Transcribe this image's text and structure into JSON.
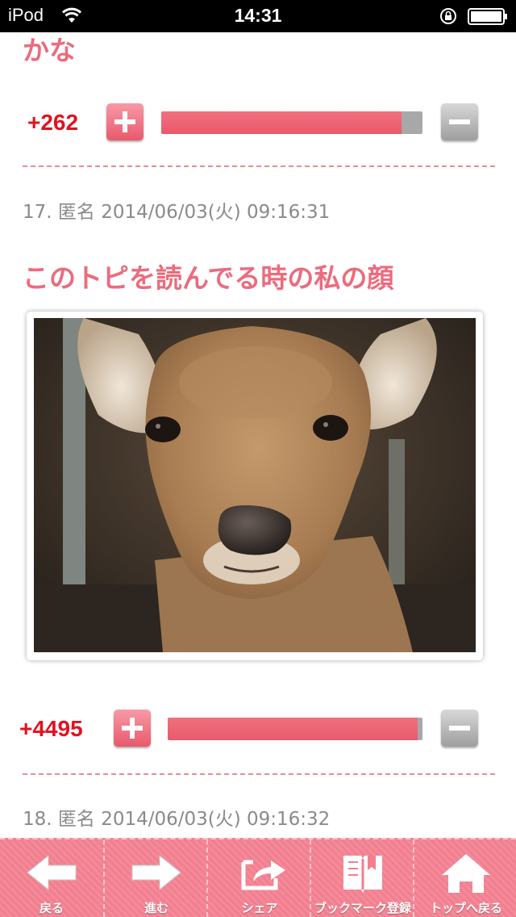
{
  "status_bar": {
    "carrier": "iPod",
    "time": "14:31"
  },
  "posts": [
    {
      "title": "かな",
      "votes": {
        "count": "+262",
        "positive_ratio": 0.92
      }
    },
    {
      "meta": "17. 匿名 2014/06/03(火) 09:16:31",
      "title": "このトピを読んでる時の私の顔",
      "votes": {
        "count": "+4495",
        "positive_ratio": 0.98
      }
    },
    {
      "meta": "18. 匿名 2014/06/03(火) 09:16:32"
    }
  ],
  "toolbar": {
    "back": "戻る",
    "forward": "進む",
    "share": "シェア",
    "bookmark": "ブックマーク登録",
    "top": "トップへ戻る"
  },
  "colors": {
    "accent": "#ec6b7d",
    "count": "#e0131e",
    "toolbar": "#f27e8f"
  },
  "icons": {
    "back": "arrow-left-icon",
    "forward": "arrow-right-icon",
    "share": "share-icon",
    "bookmark": "book-icon",
    "top": "home-icon"
  }
}
